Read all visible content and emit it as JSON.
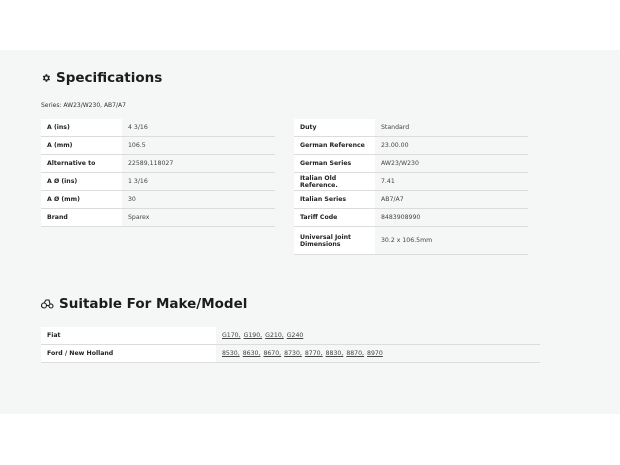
{
  "specifications": {
    "title": "Specifications",
    "icon": "gear-icon",
    "series_text": "Series: AW23/W230, AB7/A7",
    "left_rows": [
      {
        "label": "A (ins)",
        "value": "4 3/16"
      },
      {
        "label": "A (mm)",
        "value": "106.5"
      },
      {
        "label": "Alternative to",
        "value": "22589,118027"
      },
      {
        "label": "A Ø (ins)",
        "value": "1 3/16"
      },
      {
        "label": "A Ø (mm)",
        "value": "30"
      },
      {
        "label": "Brand",
        "value": "Sparex"
      }
    ],
    "right_rows": [
      {
        "label": "Duty",
        "value": "Standard"
      },
      {
        "label": "German Reference",
        "value": "23.00.00"
      },
      {
        "label": "German Series",
        "value": "AW23/W230"
      },
      {
        "label": "Italian Old Reference.",
        "value": "7.41"
      },
      {
        "label": "Italian Series",
        "value": "AB7/A7"
      },
      {
        "label": "Tariff Code",
        "value": "8483908990"
      },
      {
        "label": "Universal Joint Dimensions",
        "value": "30.2 x 106.5mm"
      }
    ]
  },
  "suitable": {
    "title": "Suitable For Make/Model",
    "icon": "tractor-icon",
    "rows": [
      {
        "make": "Fiat",
        "models": [
          "G170",
          "G190",
          "G210",
          "G240"
        ]
      },
      {
        "make": "Ford / New Holland",
        "models": [
          "8530",
          "8630",
          "8670",
          "8730",
          "8770",
          "8830",
          "8870",
          "8970"
        ]
      }
    ]
  }
}
